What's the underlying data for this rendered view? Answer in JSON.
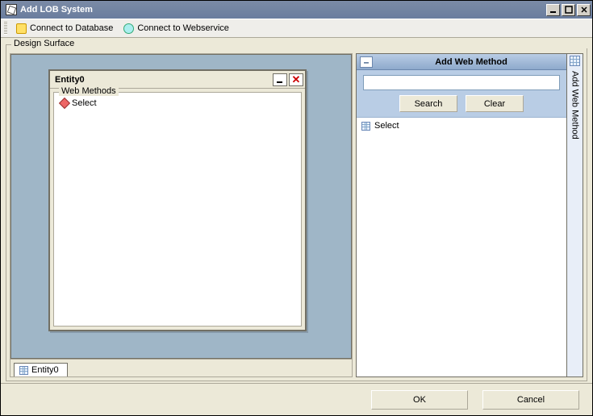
{
  "window": {
    "title": "Add LOB System"
  },
  "toolbar": {
    "connect_db": "Connect to Database",
    "connect_ws": "Connect to Webservice"
  },
  "design_surface": {
    "label": "Design Surface"
  },
  "entity": {
    "title": "Entity0",
    "group_label": "Web Methods",
    "items": [
      "Select"
    ]
  },
  "tabs": {
    "items": [
      "Entity0"
    ]
  },
  "panel": {
    "title": "Add Web Method",
    "search_value": "",
    "search_placeholder": "",
    "search_btn": "Search",
    "clear_btn": "Clear",
    "list": [
      "Select"
    ],
    "sidebar_label": "Add Web Method"
  },
  "footer": {
    "ok": "OK",
    "cancel": "Cancel"
  }
}
